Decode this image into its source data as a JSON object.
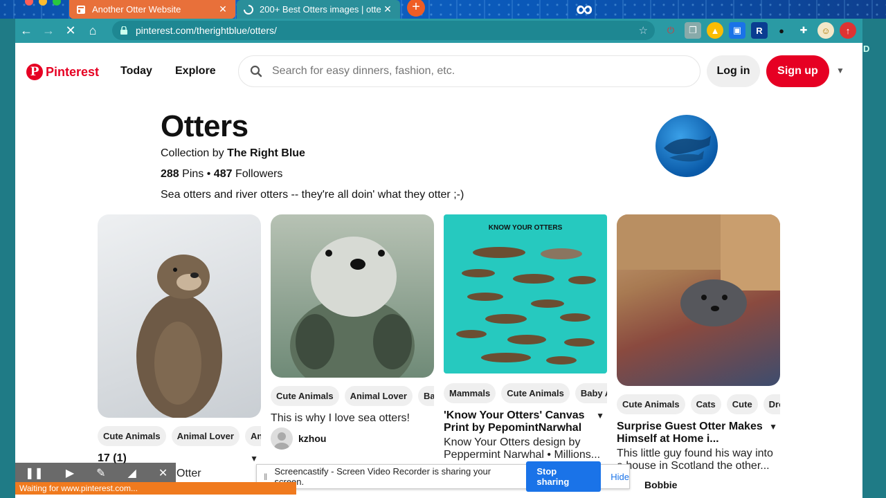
{
  "browser": {
    "tabs": [
      {
        "title": "Another Otter Website",
        "active": false
      },
      {
        "title": "200+ Best Otters images | otte",
        "active": true
      }
    ],
    "url": "pinterest.com/therightblue/otters/",
    "status_text": "Waiting for www.pinterest.com..."
  },
  "header": {
    "logo": "Pinterest",
    "nav": [
      "Today",
      "Explore"
    ],
    "search_placeholder": "Search for easy dinners, fashion, etc.",
    "login": "Log in",
    "signup": "Sign up"
  },
  "board": {
    "title": "Otters",
    "collection_prefix": "Collection by",
    "owner": "The Right Blue",
    "pins_count": "288",
    "pins_label": "Pins",
    "sep": "•",
    "followers_count": "487",
    "followers_label": "Followers",
    "description": "Sea otters and river otters -- they're all doin' what they otter ;-)"
  },
  "pins": [
    {
      "chips": [
        "Cute Animals",
        "Animal Lover",
        "Anim"
      ],
      "title": "17 (1)",
      "desc": "",
      "user": "",
      "extra": "Otter"
    },
    {
      "chips": [
        "Cute Animals",
        "Animal Lover",
        "Baby"
      ],
      "title": "",
      "desc": "This is why I love sea otters!",
      "user": "kzhou",
      "extra": ""
    },
    {
      "chips": [
        "Mammals",
        "Cute Animals",
        "Baby Ar"
      ],
      "title": "'Know Your Otters' Canvas Print by PepomintNarwhal",
      "desc": "Know Your Otters design by Peppermint Narwhal • Millions...",
      "user": "",
      "poster": "KNOW YOUR OTTERS",
      "extra": ""
    },
    {
      "chips": [
        "Cute Animals",
        "Cats",
        "Cute",
        "Drop"
      ],
      "title": "Surprise Guest Otter Makes Himself at Home i...",
      "desc": "This little guy found his way into a house in Scotland the other...",
      "user": "Bobbie",
      "extra": ""
    }
  ],
  "screencastify": {
    "message": "Screencastify - Screen Video Recorder is sharing your screen.",
    "stop": "Stop sharing",
    "hide": "Hide"
  },
  "colors": {
    "brand": "#e60023",
    "chrome": "#2a9aa4",
    "share_blue": "#1a73e8"
  }
}
